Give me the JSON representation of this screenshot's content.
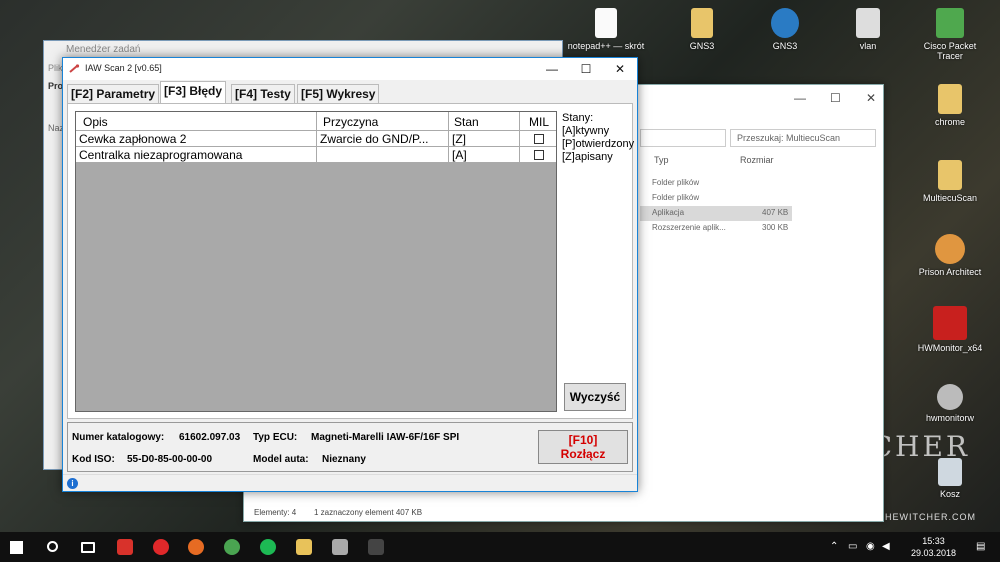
{
  "desktop": {
    "icons": [
      {
        "label": "notepad++ — skrót"
      },
      {
        "label": "GNS3"
      },
      {
        "label": "GNS3"
      },
      {
        "label": "vlan"
      },
      {
        "label": "Cisco Packet Tracer"
      },
      {
        "label": "chrome"
      },
      {
        "label": "MultiecuScan"
      },
      {
        "label": "Prison Architect"
      },
      {
        "label": "HWMonitor_x64"
      },
      {
        "label": "hwmonitorw"
      },
      {
        "label": "Kosz"
      }
    ],
    "watermark": "WITCHER",
    "watermark_sub": "THEWITCHER.COM"
  },
  "explorer": {
    "search_placeholder": "Przeszukaj: MultiecuScan",
    "columns": {
      "type": "Typ",
      "size": "Rozmiar"
    },
    "rows": [
      {
        "type": "Folder plików",
        "size": ""
      },
      {
        "type": "Folder plików",
        "size": ""
      },
      {
        "type": "Aplikacja",
        "size": "407 KB"
      },
      {
        "type": "Rozszerzenie aplik...",
        "size": "300 KB"
      }
    ],
    "status_elements": "Elementy: 4",
    "status_selected": "1 zaznaczony element  407 KB"
  },
  "taskmgr": {
    "title": "Menedżer zadań",
    "side_labels": [
      "Plik",
      "Pro",
      "Naz"
    ]
  },
  "iaw": {
    "title": "IAW Scan 2 [v0.65]",
    "tabs": [
      {
        "label": "[F2] Parametry"
      },
      {
        "label": "[F3] Błędy"
      },
      {
        "label": "[F4] Testy"
      },
      {
        "label": "[F5] Wykresy"
      }
    ],
    "grid": {
      "headers": {
        "opis": "Opis",
        "przyczyna": "Przyczyna",
        "stan": "Stan",
        "mil": "MIL"
      },
      "rows": [
        {
          "opis": "Cewka zapłonowa 2",
          "przyczyna": "Zwarcie do GND/P...",
          "stan": "[Z]"
        },
        {
          "opis": "Centralka niezaprogramowana",
          "przyczyna": "",
          "stan": "[A]"
        }
      ]
    },
    "legend": {
      "title": "Stany:",
      "items": [
        "[A]ktywny",
        "[P]otwierdzony",
        "[Z]apisany"
      ]
    },
    "clear_label": "Wyczyść",
    "info": {
      "catalog_label": "Numer katalogowy:",
      "catalog_value": "61602.097.03",
      "ecu_label": "Typ ECU:",
      "ecu_value": "Magneti-Marelli IAW-6F/16F SPI",
      "iso_label": "Kod ISO:",
      "iso_value": "55-D0-85-00-00-00",
      "model_label": "Model auta:",
      "model_value": "Nieznany"
    },
    "disconnect": {
      "line1": "[F10]",
      "line2": "Rozłącz"
    }
  },
  "taskbar": {
    "time": "15:33",
    "date": "29.03.2018"
  }
}
